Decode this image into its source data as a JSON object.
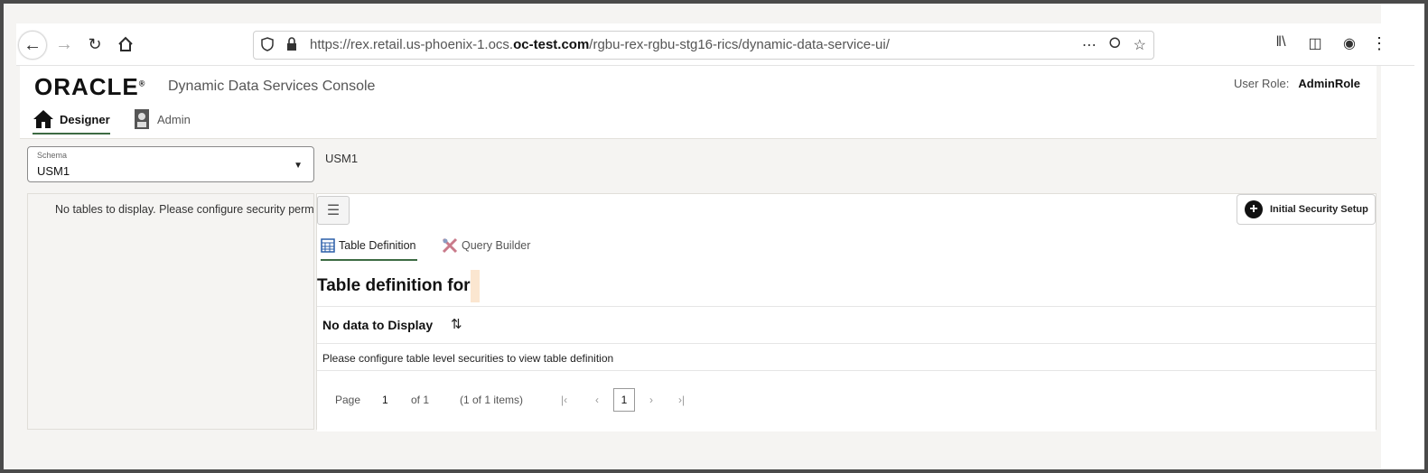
{
  "browser": {
    "url_prefix": "https://rex.retail.us-phoenix-1.ocs.",
    "url_domain": "oc-test.com",
    "url_path": "/rgbu-rex-rgbu-stg16-rics/dynamic-data-service-ui/",
    "more_icon": "⋯"
  },
  "header": {
    "brand": "ORACLE",
    "app_title": "Dynamic Data Services Console",
    "user_role_label": "User Role:",
    "user_role_value": "AdminRole"
  },
  "tabs": {
    "designer": "Designer",
    "admin": "Admin"
  },
  "schema": {
    "label": "Schema",
    "value": "USM1",
    "selected_name": "USM1"
  },
  "left_panel": {
    "message": "No tables to display. Please configure security perm"
  },
  "right_panel": {
    "setup_button": "Initial Security Setup",
    "subtabs": {
      "table_definition": "Table Definition",
      "query_builder": "Query Builder"
    },
    "definition_title": "Table definition for",
    "no_data_header": "No data to Display",
    "no_data_message": "Please configure table level securities to view table definition"
  },
  "pager": {
    "page_label": "Page",
    "page_value": "1",
    "of_label": "of 1",
    "items_label": "(1 of 1 items)",
    "current_page": "1"
  }
}
